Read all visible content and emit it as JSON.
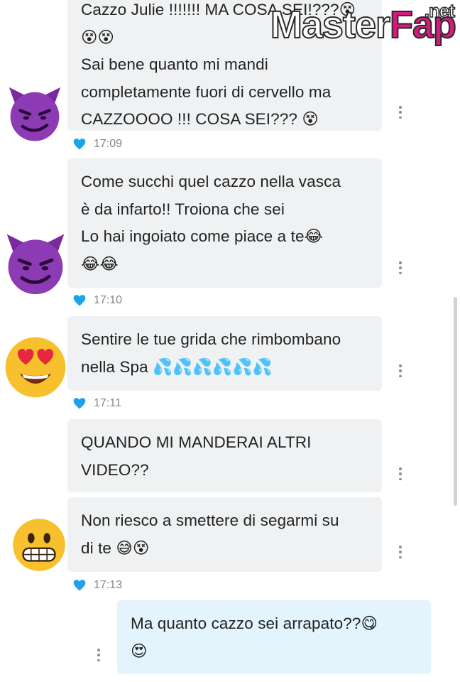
{
  "watermark": {
    "brand": "MasterFap",
    "part1": "Master",
    "part2": "Fap",
    "suffix": ".net"
  },
  "messages": [
    {
      "lines": [
        "Cazzo Julie !!!!!!! MA COSA SEI!???😵",
        "😵😵",
        "Sai bene quanto mi mandi",
        "completamente fuori di cervello ma",
        "CAZZOOOO !!! COSA SEI??? 😵"
      ],
      "time": "17:09",
      "avatar": "smiling-devil-icon"
    },
    {
      "lines": [
        "Come succhi quel cazzo nella vasca",
        "è da infarto!! Troiona che sei",
        "Lo hai ingoiato come piace a te😂",
        "😂😂"
      ],
      "time": "17:10",
      "avatar": "smiling-devil-icon"
    },
    {
      "lines": [
        "Sentire le tue grida che rimbombano",
        "nella Spa 💦💦💦💦💦💦"
      ],
      "time": "17:11",
      "avatar": "heart-eyes-icon"
    },
    {
      "lines": [
        "QUANDO MI MANDERAI ALTRI",
        "VIDEO??"
      ],
      "time": "",
      "avatar": ""
    },
    {
      "lines": [
        "Non riesco a smettere di segarmi su",
        "di te 😅😵"
      ],
      "time": "17:13",
      "avatar": "grimacing-face-icon"
    }
  ],
  "reply": {
    "lines": [
      "Ma quanto cazzo sei arrapato??😋",
      "😍"
    ]
  },
  "colors": {
    "incoming_bubble": "#eff1f3",
    "outgoing_bubble": "#e3f4fd",
    "heart": "#1fa3e8",
    "time": "#7d8790"
  }
}
